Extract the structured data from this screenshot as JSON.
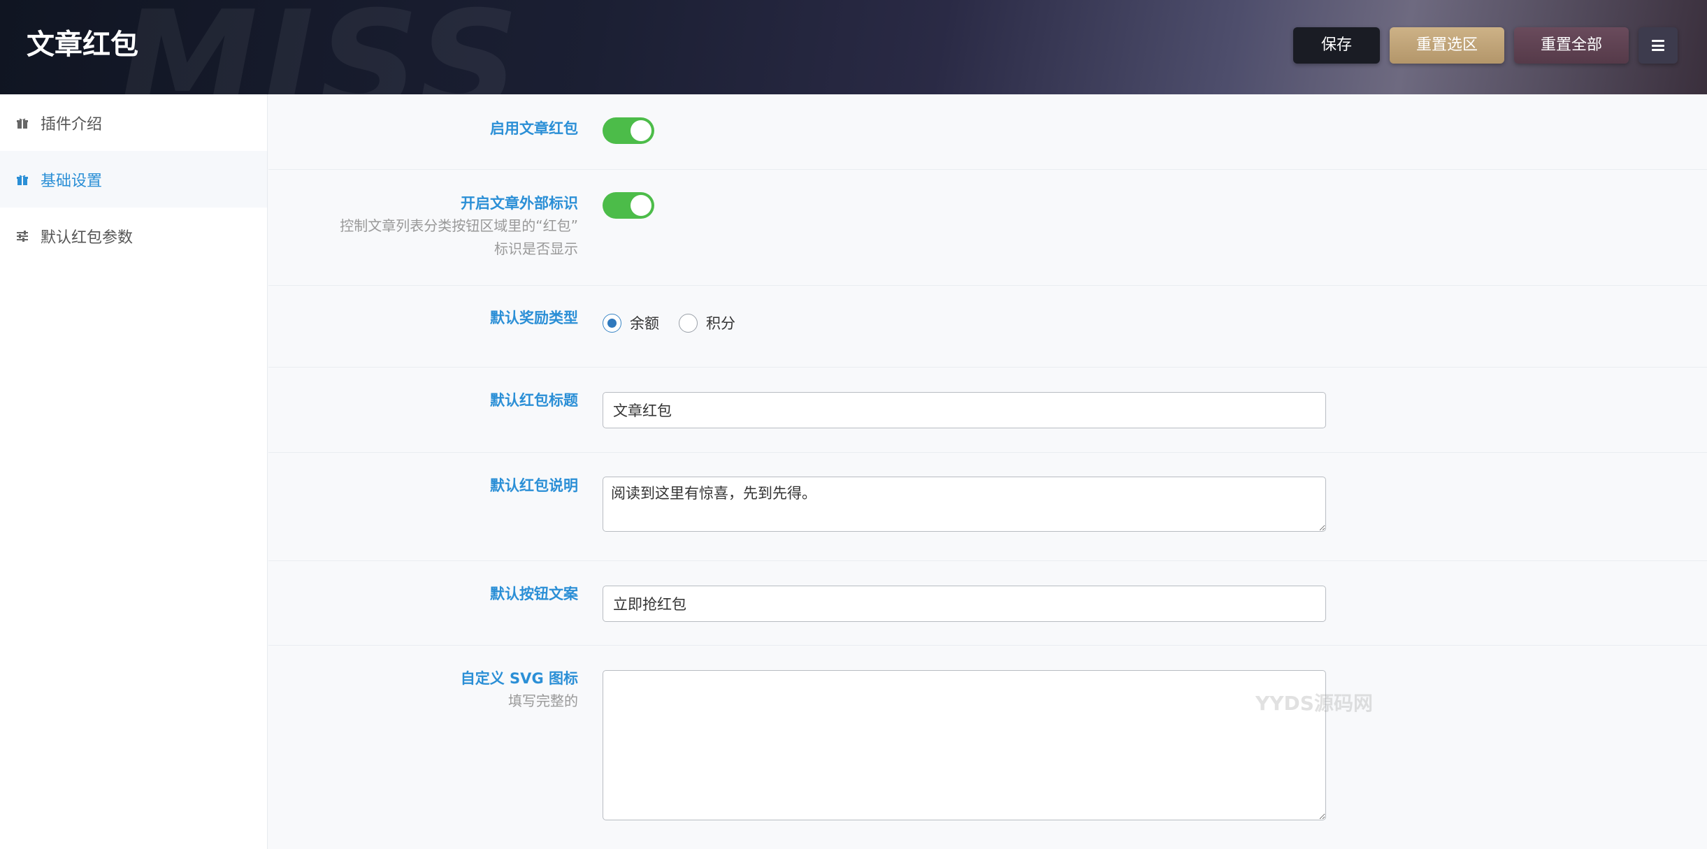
{
  "header": {
    "title": "文章红包",
    "watermark": "MISS",
    "buttons": {
      "save": "保存",
      "reset_section": "重置选区",
      "reset_all": "重置全部"
    }
  },
  "sidebar": {
    "items": [
      {
        "label": "插件介绍",
        "icon": "gift-icon",
        "active": false
      },
      {
        "label": "基础设置",
        "icon": "gift-icon",
        "active": true
      },
      {
        "label": "默认红包参数",
        "icon": "sliders-icon",
        "active": false
      }
    ]
  },
  "form": {
    "enable": {
      "label": "启用文章红包",
      "value": true
    },
    "external_mark": {
      "label": "开启文章外部标识",
      "desc_line1": "控制文章列表分类按钮区域里的“红包”",
      "desc_line2": "标识是否显示",
      "value": true
    },
    "reward_type": {
      "label": "默认奖励类型",
      "options": [
        "余额",
        "积分"
      ],
      "selected": "余额"
    },
    "title": {
      "label": "默认红包标题",
      "value": "文章红包"
    },
    "description": {
      "label": "默认红包说明",
      "value": "阅读到这里有惊喜，先到先得。"
    },
    "button_text": {
      "label": "默认按钮文案",
      "value": "立即抢红包"
    },
    "svg_icon": {
      "label": "自定义 SVG 图标",
      "desc": "填写完整的",
      "value": ""
    }
  },
  "watermark": "YYDS源码网",
  "colors": {
    "accent": "#2b8fd6",
    "toggle_on": "#4cbc49",
    "reset_section_bg": "#c2a67b",
    "reset_all_bg": "#5f4453"
  }
}
